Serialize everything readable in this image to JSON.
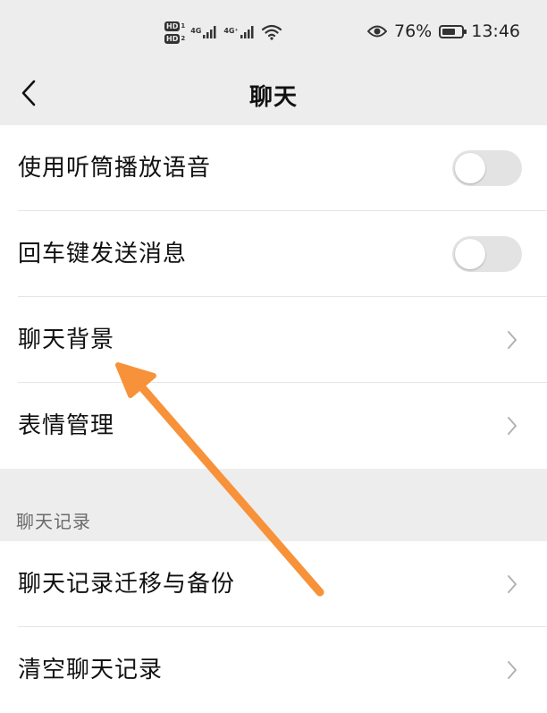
{
  "status_bar": {
    "hd_badges": [
      {
        "hd": "HD",
        "num": "1"
      },
      {
        "hd": "HD",
        "num": "2"
      }
    ],
    "signal_1_tag": "4G",
    "signal_2_tag": "4G⁺",
    "battery_percent": "76%",
    "time": "13:46",
    "battery_level": 0.76,
    "icons": [
      "eye-icon",
      "wifi-icon",
      "battery-icon",
      "signal-icon"
    ]
  },
  "nav": {
    "title": "聊天",
    "back_icon": "chevron-left-icon"
  },
  "settings_group_1": {
    "items": [
      {
        "label": "使用听筒播放语音",
        "control": "toggle",
        "on": false
      },
      {
        "label": "回车键发送消息",
        "control": "toggle",
        "on": false
      },
      {
        "label": "聊天背景",
        "control": "chevron"
      },
      {
        "label": "表情管理",
        "control": "chevron"
      }
    ]
  },
  "section_chat_history": {
    "header": "聊天记录",
    "items": [
      {
        "label": "聊天记录迁移与备份",
        "control": "chevron"
      },
      {
        "label": "清空聊天记录",
        "control": "chevron"
      }
    ]
  },
  "colors": {
    "background": "#ededed",
    "row_background": "#ffffff",
    "toggle_off": "#e3e3e3",
    "annotation_arrow": "#f7923a"
  }
}
